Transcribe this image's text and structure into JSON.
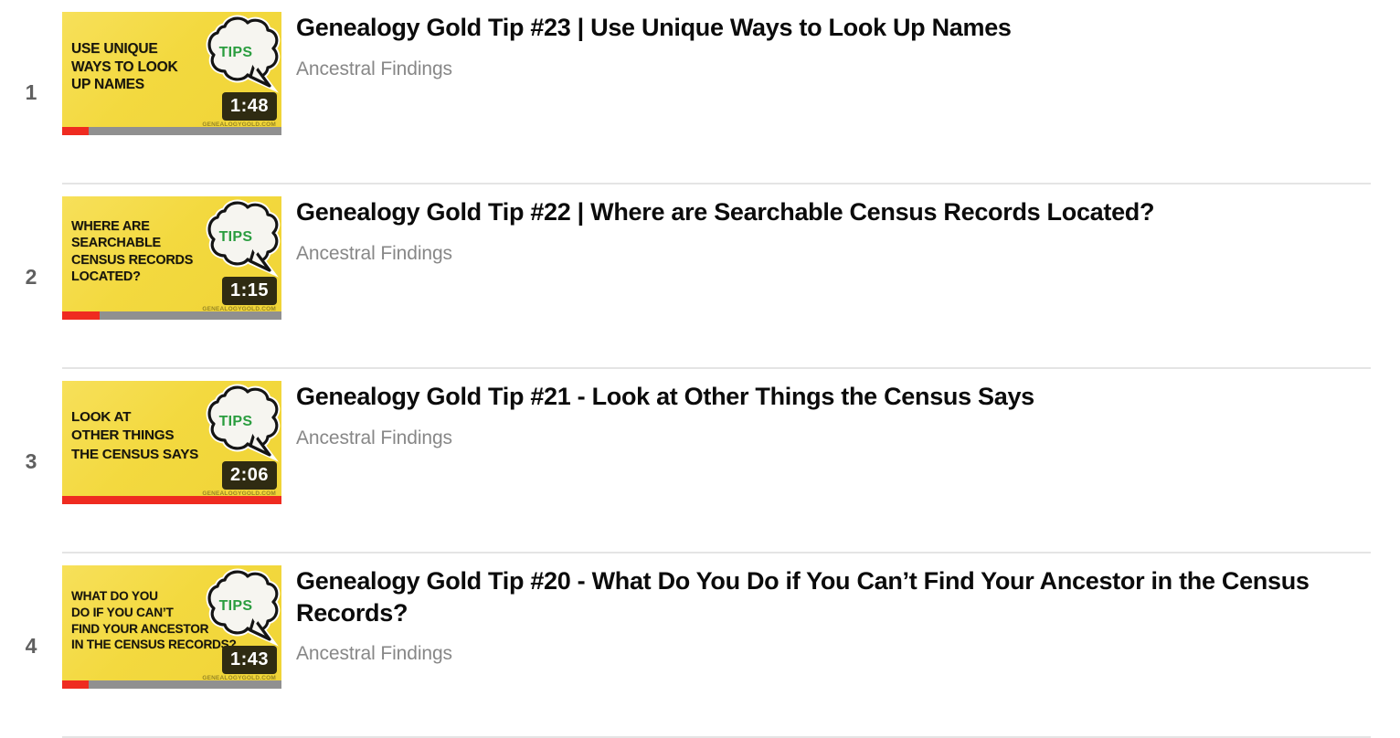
{
  "page": {
    "type": "video-playlist",
    "accent_red": "#ef2b20",
    "thumb_yellow": "#f3d93f",
    "divider_color": "#e4e4e4",
    "index_color": "#606060",
    "title_color": "#0b0b0b",
    "channel_color": "#878787",
    "badge_bg": "#2f2b12",
    "tips_green": "#2a9d3f"
  },
  "items": [
    {
      "index": "1",
      "title": "Genealogy Gold Tip #23 | Use Unique Ways to Look Up Names",
      "channel": "Ancestral Findings",
      "duration": "1:48",
      "progress_percent": 12,
      "thumbnail": {
        "badge_label": "TIPS",
        "watermark": "GENEALOGYGOLD.COM",
        "lines": [
          "USE UNIQUE",
          "WAYS TO LOOK",
          "UP NAMES"
        ]
      }
    },
    {
      "index": "2",
      "title": "Genealogy Gold Tip #22 | Where are Searchable Census Records Located?",
      "channel": "Ancestral Findings",
      "duration": "1:15",
      "progress_percent": 17,
      "thumbnail": {
        "badge_label": "TIPS",
        "watermark": "GENEALOGYGOLD.COM",
        "lines": [
          "WHERE ARE",
          "SEARCHABLE",
          "CENSUS RECORDS",
          "LOCATED?"
        ]
      }
    },
    {
      "index": "3",
      "title": "Genealogy Gold Tip #21 - Look at Other Things the Census Says",
      "channel": "Ancestral Findings",
      "duration": "2:06",
      "progress_percent": 100,
      "thumbnail": {
        "badge_label": "TIPS",
        "watermark": "GENEALOGYGOLD.COM",
        "lines": [
          "LOOK AT",
          "OTHER THINGS",
          "THE CENSUS SAYS"
        ]
      }
    },
    {
      "index": "4",
      "title": "Genealogy Gold Tip #20 - What Do You Do if You Can’t Find Your Ancestor in the Census Records?",
      "channel": "Ancestral Findings",
      "duration": "1:43",
      "progress_percent": 12,
      "thumbnail": {
        "badge_label": "TIPS",
        "watermark": "GENEALOGYGOLD.COM",
        "lines": [
          "WHAT DO YOU",
          "DO IF YOU CAN’T",
          "FIND YOUR ANCESTOR",
          "IN THE CENSUS RECORDS?"
        ]
      }
    }
  ]
}
